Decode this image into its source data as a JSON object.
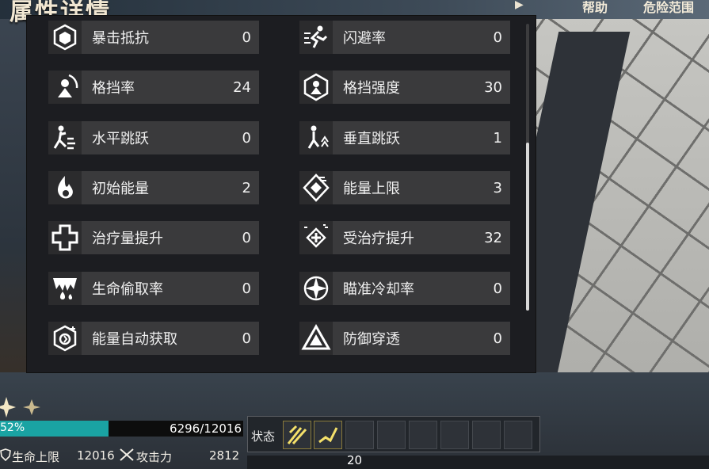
{
  "header": {
    "title": "属性详情",
    "help": "帮助",
    "danger_range": "危险范围"
  },
  "stats": [
    {
      "label": "暴击抵抗",
      "value": "0",
      "icon": "crit-resist-icon"
    },
    {
      "label": "闪避率",
      "value": "0",
      "icon": "dodge-icon"
    },
    {
      "label": "格挡率",
      "value": "24",
      "icon": "block-rate-icon"
    },
    {
      "label": "格挡强度",
      "value": "30",
      "icon": "block-strength-icon"
    },
    {
      "label": "水平跳跃",
      "value": "0",
      "icon": "horizontal-jump-icon"
    },
    {
      "label": "垂直跳跃",
      "value": "1",
      "icon": "vertical-jump-icon"
    },
    {
      "label": "初始能量",
      "value": "2",
      "icon": "initial-energy-icon"
    },
    {
      "label": "能量上限",
      "value": "3",
      "icon": "energy-cap-icon"
    },
    {
      "label": "治疗量提升",
      "value": "0",
      "icon": "healing-boost-icon"
    },
    {
      "label": "受治疗提升",
      "value": "32",
      "icon": "received-heal-icon"
    },
    {
      "label": "生命偷取率",
      "value": "0",
      "icon": "lifesteal-icon"
    },
    {
      "label": "瞄准冷却率",
      "value": "0",
      "icon": "aim-cooldown-icon"
    },
    {
      "label": "能量自动获取",
      "value": "0",
      "icon": "energy-regen-icon"
    },
    {
      "label": "防御穿透",
      "value": "0",
      "icon": "defense-pierce-icon"
    }
  ],
  "hud": {
    "hp_percent_text": "52%",
    "hp_fraction": 0.52,
    "hp_value": "6296/12016",
    "max_hp_label": "生命上限",
    "max_hp_value": "12016",
    "attack_label": "攻击力",
    "attack_value": "2812",
    "status_label": "状态",
    "bottom_counter": "20"
  },
  "colors": {
    "panel_bg": "#1c1d21",
    "row_bg": "#3a3a3c",
    "hp_fill": "#1aa3a3",
    "title": "#f1e7d2"
  }
}
